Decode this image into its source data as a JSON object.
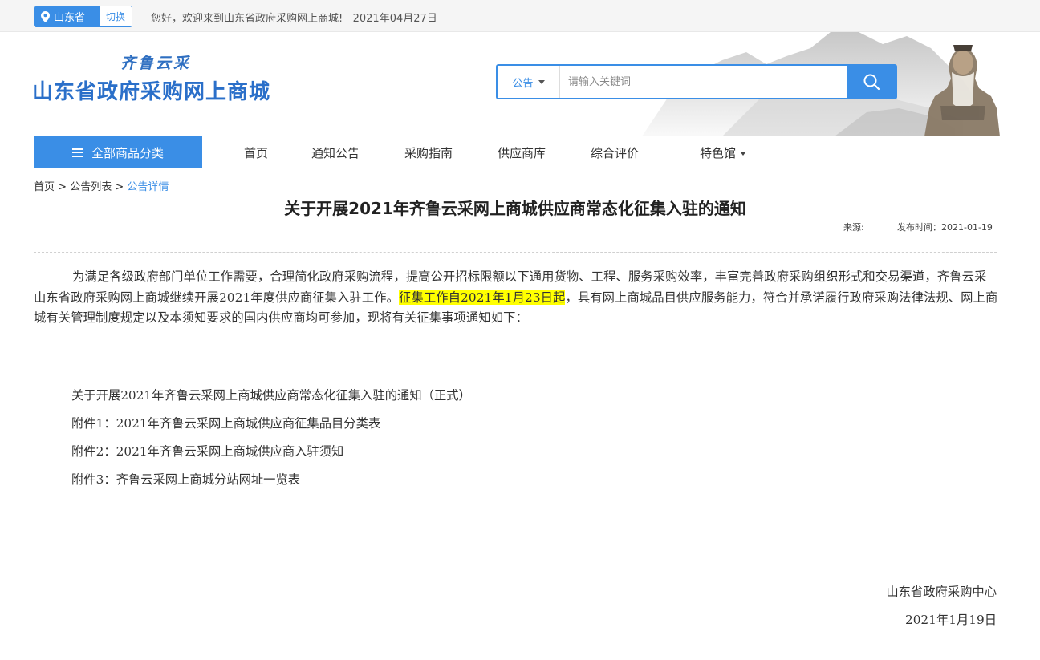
{
  "topbar": {
    "province": "山东省",
    "switch_label": "切换",
    "welcome": "您好，欢迎来到山东省政府采购网上商城!   2021年04月27日"
  },
  "header": {
    "logo_sub": "齐鲁云采",
    "logo_main": "山东省政府采购网上商城"
  },
  "search": {
    "type_label": "公告",
    "placeholder": "请输入关键词",
    "value": ""
  },
  "nav": {
    "category_button": "全部商品分类",
    "items": [
      "首页",
      "通知公告",
      "采购指南",
      "供应商库",
      "综合评价",
      "特色馆"
    ]
  },
  "breadcrumb": {
    "home": "首页",
    "sep1": " > ",
    "list": "公告列表",
    "sep2": " > ",
    "current": "公告详情"
  },
  "article": {
    "title": "关于开展2021年齐鲁云采网上商城供应商常态化征集入驻的通知",
    "source_label": "来源:",
    "publish_label": "发布时间：2021-01-19",
    "para_before": "为满足各级政府部门单位工作需要，合理简化政府采购流程，提高公开招标限额以下通用货物、工程、服务采购效率，丰富完善政府采购组织形式和交易渠道，齐鲁云采山东省政府采购网上商城继续开展2021年度供应商征集入驻工作。",
    "para_highlight": "征集工作自2021年1月23日起",
    "para_after": "，具有网上商城品目供应服务能力，符合并承诺履行政府采购法律法规、网上商城有关管理制度规定以及本须知要求的国内供应商均可参加，现将有关征集事项通知如下：",
    "attachments": [
      "关于开展2021年齐鲁云采网上商城供应商常态化征集入驻的通知（正式）",
      "附件1：2021年齐鲁云采网上商城供应商征集品目分类表",
      "附件2：2021年齐鲁云采网上商城供应商入驻须知",
      "附件3：齐鲁云采网上商城分站网址一览表"
    ],
    "signer": "山东省政府采购中心",
    "sign_date": "2021年1月19日"
  },
  "icons": {
    "location": "location-pin-icon",
    "search": "search-icon",
    "menu": "menu-icon",
    "dropdown": "chevron-down-icon"
  },
  "colors": {
    "accent": "#3a8ee6",
    "highlight": "#ffff00",
    "logo": "#2a6fc9"
  }
}
